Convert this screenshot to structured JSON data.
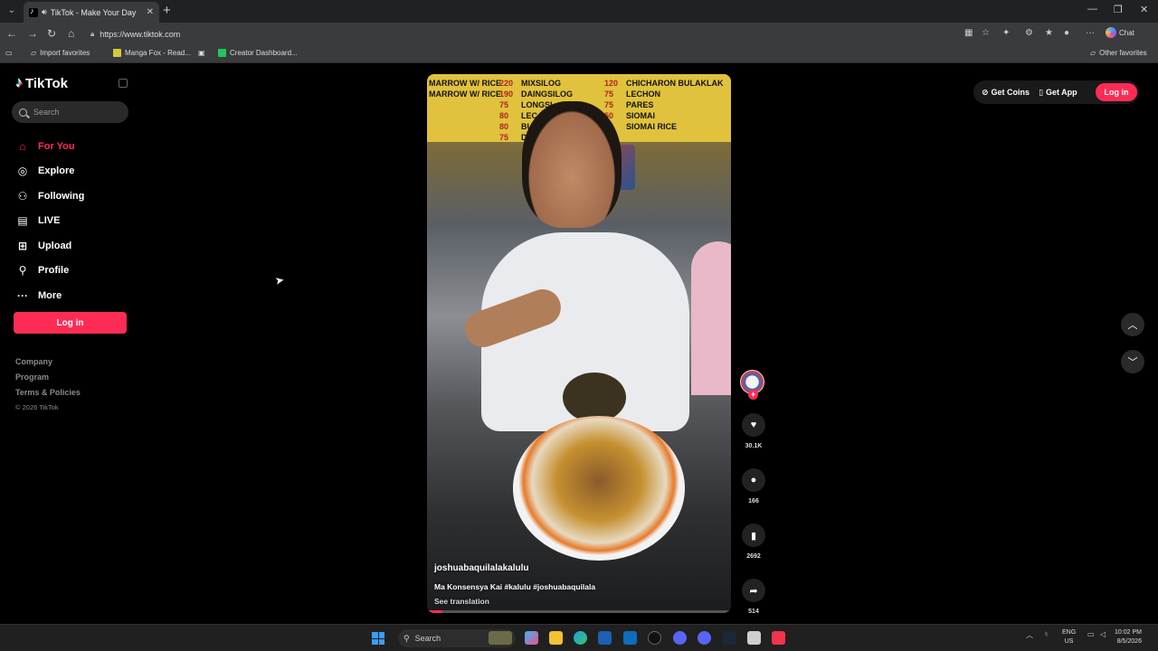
{
  "browser": {
    "tab_title": "TikTok - Make Your Day",
    "url": "https://www.tiktok.com",
    "chat_label": "Chat",
    "favorites": [
      "Import favorites",
      "Manga Fox - Read...",
      "Creator Dashboard..."
    ],
    "other_favorites": "Other favorites"
  },
  "sidebar": {
    "logo": "TikTok",
    "search_placeholder": "Search",
    "nav": [
      {
        "label": "For You",
        "icon": "home-icon"
      },
      {
        "label": "Explore",
        "icon": "compass-icon"
      },
      {
        "label": "Following",
        "icon": "following-icon"
      },
      {
        "label": "LIVE",
        "icon": "live-icon"
      },
      {
        "label": "Upload",
        "icon": "upload-icon"
      },
      {
        "label": "Profile",
        "icon": "profile-icon"
      },
      {
        "label": "More",
        "icon": "more-icon"
      }
    ],
    "login_label": "Log in",
    "footer": [
      "Company",
      "Program",
      "Terms & Policies"
    ],
    "copyright": "© 2026 TikTok"
  },
  "header": {
    "get_coins": "Get Coins",
    "get_app": "Get App",
    "login": "Log in"
  },
  "video": {
    "author": "joshuabaquilalakalulu",
    "caption": "Ma Konsensya Kai #kalulu #joshuabaquilala",
    "see_translation": "See translation",
    "menu_left": "MARROW W/ RICE\nMARROW W/ RICE",
    "menu_prices_left": "220\n190\n75\n80\n80\n75",
    "menu_mid": "MIXSILOG\nDAINGSILOG\nLONGSI\nLEC\nBU\nDI",
    "menu_prices_mid": "120\n75\n75\n50",
    "menu_right": "CHICHARON BULAKLAK\nLECHON\nPARES\nSIOMAI\nSIOMAI RICE",
    "progress_fraction": 0.05,
    "likes": "30.1K",
    "comments": "166",
    "saves": "2692",
    "shares": "514"
  },
  "colors": {
    "accent": "#fe2c55",
    "background": "#000000"
  },
  "taskbar": {
    "search_placeholder": "Search",
    "lang_top": "ENG",
    "lang_bottom": "US",
    "time": "10:02 PM",
    "date": "8/5/2026"
  }
}
